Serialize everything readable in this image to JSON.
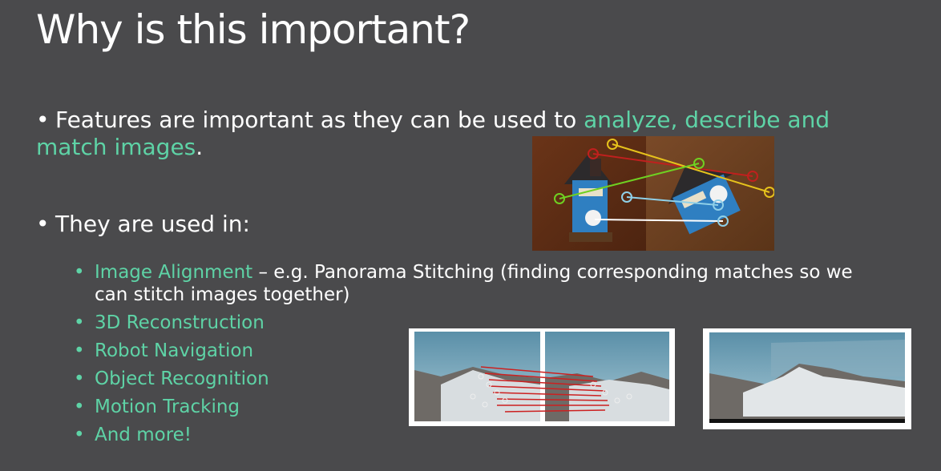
{
  "slide": {
    "title": "Why is this important?",
    "bullet1": {
      "text": "Features are important as they can be used to ",
      "highlight": "analyze, describe and match images",
      "end": "."
    },
    "bullet2": "They are used in:",
    "sub_items": [
      {
        "label": "Image Alignment",
        "rest": " – e.g. Panorama Stitching (finding corresponding matches so we can stitch images together)"
      },
      {
        "label": "3D Reconstruction",
        "rest": ""
      },
      {
        "label": "Robot Navigation",
        "rest": ""
      },
      {
        "label": "Object Recognition",
        "rest": ""
      },
      {
        "label": "Motion Tracking",
        "rest": ""
      },
      {
        "label": "And more!",
        "rest": ""
      }
    ]
  },
  "colors": {
    "background": "#4a4a4c",
    "accent": "#5ed3a6",
    "text": "#ffffff"
  }
}
